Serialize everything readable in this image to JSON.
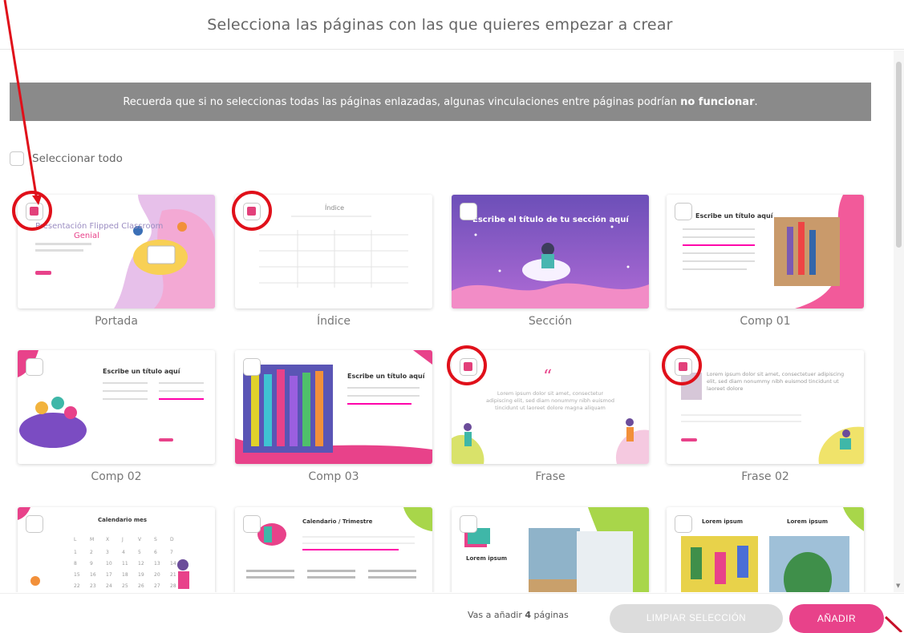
{
  "header": {
    "title": "Selecciona las páginas con las que quieres empezar a crear"
  },
  "notice": {
    "text": "Recuerda que si no seleccionas todas las páginas enlazadas, algunas vinculaciones entre páginas podrían",
    "bold": "no funcionar",
    "end": "."
  },
  "select_all": {
    "label": "Seleccionar todo",
    "checked": false
  },
  "cards": [
    {
      "label": "Portada",
      "checked": true,
      "highlighted": true,
      "theme": "cover"
    },
    {
      "label": "Índice",
      "checked": true,
      "highlighted": true,
      "theme": "index"
    },
    {
      "label": "Sección",
      "checked": false,
      "highlighted": false,
      "theme": "section"
    },
    {
      "label": "Comp 01",
      "checked": false,
      "highlighted": false,
      "theme": "comp01"
    },
    {
      "label": "Comp 02",
      "checked": false,
      "highlighted": false,
      "theme": "comp02"
    },
    {
      "label": "Comp 03",
      "checked": false,
      "highlighted": false,
      "theme": "comp03"
    },
    {
      "label": "Frase",
      "checked": true,
      "highlighted": true,
      "theme": "quote"
    },
    {
      "label": "Frase 02",
      "checked": true,
      "highlighted": true,
      "theme": "quote02"
    },
    {
      "label": "",
      "checked": false,
      "highlighted": false,
      "theme": "calendar"
    },
    {
      "label": "",
      "checked": false,
      "highlighted": false,
      "theme": "calendar2"
    },
    {
      "label": "",
      "checked": false,
      "highlighted": false,
      "theme": "photos"
    },
    {
      "label": "",
      "checked": false,
      "highlighted": false,
      "theme": "photos2"
    }
  ],
  "thumb_text": {
    "cover": "Presentación Flipped Classroom",
    "cover_accent": "Genial",
    "index": "Índice",
    "section": "Escribe el título de tu sección aquí",
    "comp01": "Escribe un título aquí",
    "comp02": "Escribe un título aquí",
    "comp03": "Escribe un título aquí",
    "quote": "Lorem ipsum dolor sit amet, consectetur adipiscing elit, sed diam nonummy nibh euismod tincidunt ut laoreet dolore magna aliquam",
    "quote02": "Lorem ipsum dolor sit amet, consectetuer adipiscing elit, sed diam nonummy nibh euismod tincidunt ut laoreet dolore",
    "calendar": "Calendario mes",
    "calendar2": "Calendario / Trimestre",
    "photos": "Lorem ipsum",
    "photos2a": "Lorem ipsum",
    "photos2b": "Lorem ipsum"
  },
  "footer": {
    "info_prefix": "Vas a añadir",
    "info_count": "4",
    "info_suffix": "páginas",
    "clear_label": "LIMPIAR SELECCIÓN",
    "add_label": "AÑADIR"
  },
  "colors": {
    "accent": "#e8428a",
    "check": "#e2407a",
    "highlight": "#e0101a",
    "notice_bg": "#8a8a8a",
    "clear_btn": "#dcdcdc"
  }
}
